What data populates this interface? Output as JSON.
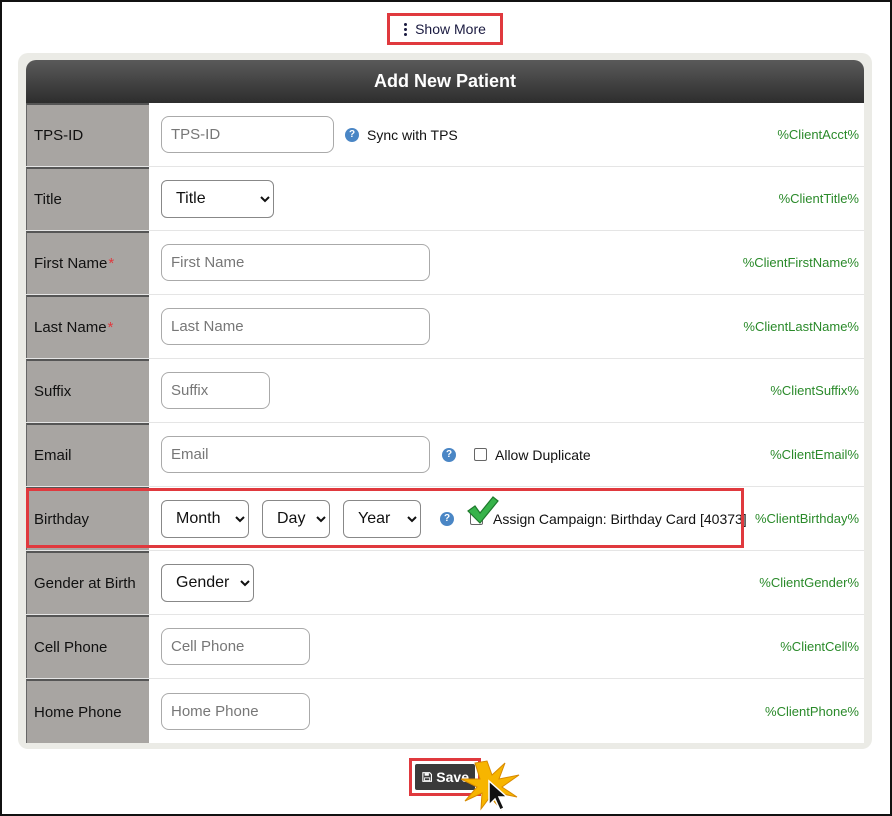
{
  "show_more": {
    "label": "Show More",
    "icon": "kebab-icon"
  },
  "form": {
    "title": "Add New Patient",
    "rows": {
      "tps_id": {
        "label": "TPS-ID",
        "placeholder": "TPS-ID",
        "value": "",
        "sync_label": "Sync with TPS",
        "merge_tag": "%ClientAcct%"
      },
      "title": {
        "label": "Title",
        "selected": "Title",
        "merge_tag": "%ClientTitle%"
      },
      "first_name": {
        "label": "First Name",
        "required": "*",
        "placeholder": "First Name",
        "value": "",
        "merge_tag": "%ClientFirstName%"
      },
      "last_name": {
        "label": "Last Name",
        "required": "*",
        "placeholder": "Last Name",
        "value": "",
        "merge_tag": "%ClientLastName%"
      },
      "suffix": {
        "label": "Suffix",
        "placeholder": "Suffix",
        "value": "",
        "merge_tag": "%ClientSuffix%"
      },
      "email": {
        "label": "Email",
        "placeholder": "Email",
        "value": "",
        "allow_duplicate_label": "Allow Duplicate",
        "allow_duplicate_checked": false,
        "merge_tag": "%ClientEmail%"
      },
      "birthday": {
        "label": "Birthday",
        "month": "Month",
        "day": "Day",
        "year": "Year",
        "assign_campaign_label": "Assign Campaign: Birthday Card [40373]",
        "assign_campaign_checked": true,
        "merge_tag": "%ClientBirthday%"
      },
      "gender": {
        "label": "Gender at Birth",
        "selected": "Gender",
        "merge_tag": "%ClientGender%"
      },
      "cell_phone": {
        "label": "Cell Phone",
        "placeholder": "Cell Phone",
        "value": "",
        "merge_tag": "%ClientCell%"
      },
      "home_phone": {
        "label": "Home Phone",
        "placeholder": "Home Phone",
        "value": "",
        "merge_tag": "%ClientPhone%"
      }
    }
  },
  "save": {
    "label": "Save",
    "icon": "floppy-disk-icon"
  },
  "colors": {
    "highlight": "#e0393e",
    "merge_tag": "#2a8a2a",
    "label_bg": "#a8a5a2",
    "header_bg": "#2d2d2d",
    "help_icon": "#4a86c5"
  }
}
